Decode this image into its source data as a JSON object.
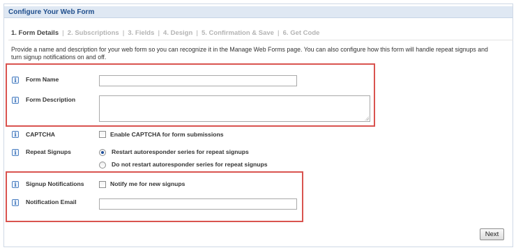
{
  "header": {
    "title": "Configure Your Web Form"
  },
  "steps": [
    {
      "label": "1. Form Details",
      "active": true
    },
    {
      "label": "2. Subscriptions",
      "active": false
    },
    {
      "label": "3. Fields",
      "active": false
    },
    {
      "label": "4. Design",
      "active": false
    },
    {
      "label": "5. Confirmation & Save",
      "active": false
    },
    {
      "label": "6. Get Code",
      "active": false
    }
  ],
  "step_separator": "|",
  "intro": "Provide a name and description for your web form so you can recognize it in the Manage Web Forms page. You can also configure how this form will handle repeat signups and turn signup notifications on and off.",
  "info_glyph": "i",
  "fields": {
    "form_name": {
      "label": "Form Name",
      "value": ""
    },
    "form_description": {
      "label": "Form Description",
      "value": ""
    },
    "captcha": {
      "label": "CAPTCHA",
      "option": "Enable CAPTCHA for form submissions",
      "checked": false
    },
    "repeat_signups": {
      "label": "Repeat Signups",
      "options": [
        {
          "label": "Restart autoresponder series for repeat signups",
          "selected": true
        },
        {
          "label": "Do not restart autoresponder series for repeat signups",
          "selected": false
        }
      ]
    },
    "signup_notifications": {
      "label": "Signup Notifications",
      "option": "Notify me for new signups",
      "checked": false
    },
    "notification_email": {
      "label": "Notification Email",
      "value": ""
    }
  },
  "next_label": "Next",
  "colors": {
    "header_bg": "#dfe8f3",
    "header_text": "#1f4e8c",
    "highlight": "#d9534f",
    "info_icon": "#2d67b2"
  }
}
